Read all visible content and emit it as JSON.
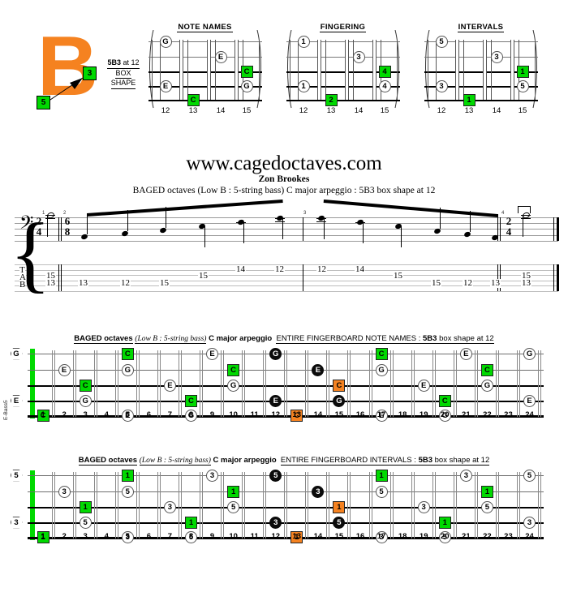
{
  "logo": {
    "letter": "B",
    "chip_3": "3",
    "chip_5": "5",
    "caption_line1_bold": "5B3",
    "caption_line1_rest": " at 12",
    "caption_line2": "BOX",
    "caption_line3": "SHAPE"
  },
  "colors": {
    "green": "#00D900",
    "orange": "#F58220",
    "black": "#0b0b0b",
    "open": "#ffffff"
  },
  "box_shapes": [
    {
      "title": "NOTE NAMES",
      "frets": [
        "12",
        "13",
        "14",
        "15"
      ],
      "markers": [
        {
          "string": 5,
          "fret": 12,
          "label": "G",
          "style": "open"
        },
        {
          "string": 4,
          "fret": 14,
          "label": "E",
          "style": "open"
        },
        {
          "string": 3,
          "fret": 15,
          "label": "C",
          "style": "green"
        },
        {
          "string": 2,
          "fret": 12,
          "label": "E",
          "style": "open"
        },
        {
          "string": 2,
          "fret": 15,
          "label": "G",
          "style": "open"
        },
        {
          "string": 1,
          "fret": 13,
          "label": "C",
          "style": "green"
        }
      ]
    },
    {
      "title": "FINGERING",
      "frets": [
        "12",
        "13",
        "14",
        "15"
      ],
      "markers": [
        {
          "string": 5,
          "fret": 12,
          "label": "1",
          "style": "open"
        },
        {
          "string": 4,
          "fret": 14,
          "label": "3",
          "style": "open"
        },
        {
          "string": 3,
          "fret": 15,
          "label": "4",
          "style": "green"
        },
        {
          "string": 2,
          "fret": 12,
          "label": "1",
          "style": "open"
        },
        {
          "string": 2,
          "fret": 15,
          "label": "4",
          "style": "open"
        },
        {
          "string": 1,
          "fret": 13,
          "label": "2",
          "style": "green"
        }
      ]
    },
    {
      "title": "INTERVALS",
      "frets": [
        "12",
        "13",
        "14",
        "15"
      ],
      "markers": [
        {
          "string": 5,
          "fret": 12,
          "label": "5",
          "style": "open"
        },
        {
          "string": 4,
          "fret": 14,
          "label": "3",
          "style": "open"
        },
        {
          "string": 3,
          "fret": 15,
          "label": "1",
          "style": "green"
        },
        {
          "string": 2,
          "fret": 12,
          "label": "3",
          "style": "open"
        },
        {
          "string": 2,
          "fret": 15,
          "label": "5",
          "style": "open"
        },
        {
          "string": 1,
          "fret": 13,
          "label": "1",
          "style": "green"
        }
      ]
    }
  ],
  "header": {
    "site_title": "www.cagedoctaves.com",
    "author": "Zon Brookes",
    "subtitle": "BAGED octaves (Low B : 5-string bass) C major arpeggio : 5B3 box shape at 12"
  },
  "notation": {
    "instrument_label": "E-Bass5",
    "clef": "bass-clef",
    "pickup_time_signature": "2/4",
    "main_time_signature": "6/8",
    "end_time_signature": "2/4",
    "measure_numbers": [
      "1",
      "2",
      "3",
      "4"
    ],
    "tab_letters": [
      "T",
      "A",
      "B"
    ],
    "tab_notes": [
      {
        "measure": 1,
        "string": "A",
        "fret": "15"
      },
      {
        "measure": 1,
        "string": "B",
        "fret": "13"
      },
      {
        "measure": 2,
        "string": "B",
        "fret": "13"
      },
      {
        "measure": 2,
        "string": "B",
        "fret": "12"
      },
      {
        "measure": 2,
        "string": "B",
        "fret": "15"
      },
      {
        "measure": 2,
        "string": "A",
        "fret": "15"
      },
      {
        "measure": 2,
        "string": "T",
        "fret": "14"
      },
      {
        "measure": 2,
        "string": "T",
        "fret": "12"
      },
      {
        "measure": 3,
        "string": "T",
        "fret": "12"
      },
      {
        "measure": 3,
        "string": "T",
        "fret": "14"
      },
      {
        "measure": 3,
        "string": "A",
        "fret": "15"
      },
      {
        "measure": 3,
        "string": "B",
        "fret": "15"
      },
      {
        "measure": 3,
        "string": "B",
        "fret": "12"
      },
      {
        "measure": 3,
        "string": "B",
        "fret": "13"
      },
      {
        "measure": 4,
        "string": "A",
        "fret": "15"
      },
      {
        "measure": 4,
        "string": "B",
        "fret": "13"
      }
    ]
  },
  "fretboards": [
    {
      "id": "note-names",
      "head": {
        "t1": "BAGED octaves",
        "t2": "(Low B",
        "t3": " : 5-string bass)",
        "t4": "C major arpeggio",
        "t5": "ENTIRE FINGERBOARD  NOTE NAMES",
        "t6": " : ",
        "t7": "5B3",
        "t8": " box shape at 12"
      },
      "fret_numbers": [
        "1",
        "2",
        "3",
        "4",
        "5",
        "6",
        "7",
        "8",
        "9",
        "10",
        "11",
        "12",
        "13",
        "14",
        "15",
        "16",
        "17",
        "18",
        "19",
        "20",
        "21",
        "22",
        "23",
        "24"
      ],
      "open_strings": [
        {
          "string": 5,
          "label": "G"
        },
        {
          "string": 2,
          "label": "E"
        }
      ],
      "markers": [
        {
          "string": 1,
          "fret": 1,
          "label": "C",
          "style": "green"
        },
        {
          "string": 3,
          "fret": 3,
          "label": "C",
          "style": "green"
        },
        {
          "string": 2,
          "fret": 3,
          "label": "G",
          "style": "open"
        },
        {
          "string": 4,
          "fret": 2,
          "label": "E",
          "style": "open"
        },
        {
          "string": 5,
          "fret": 5,
          "label": "C",
          "style": "green"
        },
        {
          "string": 4,
          "fret": 5,
          "label": "G",
          "style": "open"
        },
        {
          "string": 1,
          "fret": 5,
          "label": "E",
          "style": "open"
        },
        {
          "string": 3,
          "fret": 7,
          "label": "E",
          "style": "open"
        },
        {
          "string": 2,
          "fret": 8,
          "label": "C",
          "style": "green"
        },
        {
          "string": 1,
          "fret": 8,
          "label": "G",
          "style": "open"
        },
        {
          "string": 5,
          "fret": 9,
          "label": "E",
          "style": "open"
        },
        {
          "string": 4,
          "fret": 10,
          "label": "C",
          "style": "green"
        },
        {
          "string": 3,
          "fret": 10,
          "label": "G",
          "style": "open"
        },
        {
          "string": 5,
          "fret": 12,
          "label": "G",
          "style": "black"
        },
        {
          "string": 2,
          "fret": 12,
          "label": "E",
          "style": "black"
        },
        {
          "string": 1,
          "fret": 13,
          "label": "C",
          "style": "orange"
        },
        {
          "string": 4,
          "fret": 14,
          "label": "E",
          "style": "black"
        },
        {
          "string": 3,
          "fret": 15,
          "label": "C",
          "style": "orange"
        },
        {
          "string": 2,
          "fret": 15,
          "label": "G",
          "style": "black"
        },
        {
          "string": 5,
          "fret": 17,
          "label": "C",
          "style": "green"
        },
        {
          "string": 4,
          "fret": 17,
          "label": "G",
          "style": "open"
        },
        {
          "string": 1,
          "fret": 17,
          "label": "E",
          "style": "open"
        },
        {
          "string": 3,
          "fret": 19,
          "label": "E",
          "style": "open"
        },
        {
          "string": 2,
          "fret": 20,
          "label": "C",
          "style": "green"
        },
        {
          "string": 1,
          "fret": 20,
          "label": "G",
          "style": "open"
        },
        {
          "string": 5,
          "fret": 21,
          "label": "E",
          "style": "open"
        },
        {
          "string": 4,
          "fret": 22,
          "label": "C",
          "style": "green"
        },
        {
          "string": 3,
          "fret": 22,
          "label": "G",
          "style": "open"
        },
        {
          "string": 5,
          "fret": 24,
          "label": "G",
          "style": "open"
        },
        {
          "string": 2,
          "fret": 24,
          "label": "E",
          "style": "open"
        }
      ]
    },
    {
      "id": "intervals",
      "head": {
        "t1": "BAGED octaves",
        "t2": "(Low B",
        "t3": " : 5-string bass)",
        "t4": "C major arpeggio",
        "t5": "ENTIRE FINGERBOARD  INTERVALS",
        "t6": " : ",
        "t7": "5B3",
        "t8": " box shape at 12"
      },
      "fret_numbers": [
        "1",
        "2",
        "3",
        "4",
        "5",
        "6",
        "7",
        "8",
        "9",
        "10",
        "11",
        "12",
        "13",
        "14",
        "15",
        "16",
        "17",
        "18",
        "19",
        "20",
        "21",
        "22",
        "23",
        "24"
      ],
      "open_strings": [
        {
          "string": 5,
          "label": "5"
        },
        {
          "string": 2,
          "label": "3"
        }
      ],
      "markers": [
        {
          "string": 1,
          "fret": 1,
          "label": "1",
          "style": "green"
        },
        {
          "string": 3,
          "fret": 3,
          "label": "1",
          "style": "green"
        },
        {
          "string": 2,
          "fret": 3,
          "label": "5",
          "style": "open"
        },
        {
          "string": 4,
          "fret": 2,
          "label": "3",
          "style": "open"
        },
        {
          "string": 5,
          "fret": 5,
          "label": "1",
          "style": "green"
        },
        {
          "string": 4,
          "fret": 5,
          "label": "5",
          "style": "open"
        },
        {
          "string": 1,
          "fret": 5,
          "label": "3",
          "style": "open"
        },
        {
          "string": 3,
          "fret": 7,
          "label": "3",
          "style": "open"
        },
        {
          "string": 2,
          "fret": 8,
          "label": "1",
          "style": "green"
        },
        {
          "string": 1,
          "fret": 8,
          "label": "5",
          "style": "open"
        },
        {
          "string": 5,
          "fret": 9,
          "label": "3",
          "style": "open"
        },
        {
          "string": 4,
          "fret": 10,
          "label": "1",
          "style": "green"
        },
        {
          "string": 3,
          "fret": 10,
          "label": "5",
          "style": "open"
        },
        {
          "string": 5,
          "fret": 12,
          "label": "5",
          "style": "black"
        },
        {
          "string": 2,
          "fret": 12,
          "label": "3",
          "style": "black"
        },
        {
          "string": 1,
          "fret": 13,
          "label": "1",
          "style": "orange"
        },
        {
          "string": 4,
          "fret": 14,
          "label": "3",
          "style": "black"
        },
        {
          "string": 3,
          "fret": 15,
          "label": "1",
          "style": "orange"
        },
        {
          "string": 2,
          "fret": 15,
          "label": "5",
          "style": "black"
        },
        {
          "string": 5,
          "fret": 17,
          "label": "1",
          "style": "green"
        },
        {
          "string": 4,
          "fret": 17,
          "label": "5",
          "style": "open"
        },
        {
          "string": 1,
          "fret": 17,
          "label": "3",
          "style": "open"
        },
        {
          "string": 3,
          "fret": 19,
          "label": "3",
          "style": "open"
        },
        {
          "string": 2,
          "fret": 20,
          "label": "1",
          "style": "green"
        },
        {
          "string": 1,
          "fret": 20,
          "label": "5",
          "style": "open"
        },
        {
          "string": 5,
          "fret": 21,
          "label": "3",
          "style": "open"
        },
        {
          "string": 4,
          "fret": 22,
          "label": "1",
          "style": "green"
        },
        {
          "string": 3,
          "fret": 22,
          "label": "5",
          "style": "open"
        },
        {
          "string": 5,
          "fret": 24,
          "label": "5",
          "style": "open"
        },
        {
          "string": 2,
          "fret": 24,
          "label": "3",
          "style": "open"
        }
      ]
    }
  ]
}
